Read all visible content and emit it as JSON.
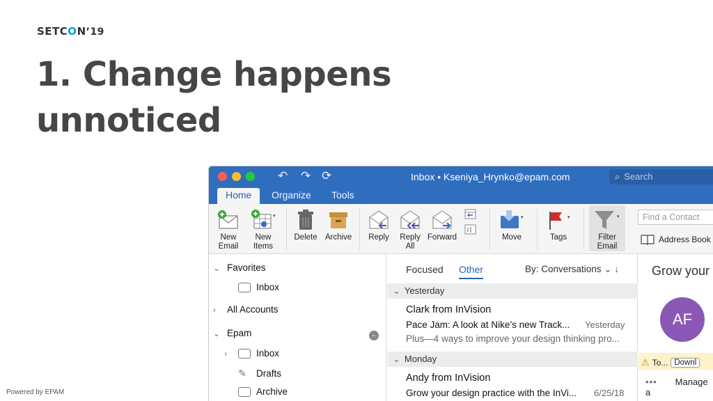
{
  "slide": {
    "logo_a": "SETC",
    "logo_o": "O",
    "logo_b": "N",
    "logo_year": "’19",
    "title_line1": "1. Change happens",
    "title_line2": "unnoticed",
    "footer": "Powered by EPAM"
  },
  "window": {
    "title": "Inbox • Kseniya_Hrynko@epam.com",
    "search_placeholder": "Search",
    "tabs": [
      {
        "label": "Home",
        "active": true
      },
      {
        "label": "Organize",
        "active": false
      },
      {
        "label": "Tools",
        "active": false
      }
    ]
  },
  "ribbon": {
    "new_email": [
      "New",
      "Email"
    ],
    "new_items": [
      "New",
      "Items"
    ],
    "delete": "Delete",
    "archive": "Archive",
    "reply": "Reply",
    "reply_all": [
      "Reply",
      "All"
    ],
    "forward": "Forward",
    "move": "Move",
    "tags": "Tags",
    "filter_email": [
      "Filter",
      "Email"
    ],
    "find_contact_placeholder": "Find a Contact",
    "address_book": "Address Book"
  },
  "folders": {
    "favorites": "Favorites",
    "fav_inbox": "Inbox",
    "all_accounts": "All Accounts",
    "epam": "Epam",
    "inbox": "Inbox",
    "drafts": "Drafts",
    "archive": "Archive"
  },
  "message_list": {
    "tab_focused": "Focused",
    "tab_other": "Other",
    "sort": "By: Conversations",
    "groups": [
      "Yesterday",
      "Monday"
    ],
    "messages": [
      {
        "from": "Clark from InVision",
        "subject": "Pace Jam: A look at Nike’s new Track...",
        "date": "Yesterday",
        "preview": "Plus—4 ways to improve your design thinking pro..."
      },
      {
        "from": "Andy from InVision",
        "subject": "Grow your design practice with the InVi...",
        "date": "6/25/18"
      }
    ]
  },
  "reading_pane": {
    "title": "Grow your",
    "avatar_initials": "AF",
    "info_text": "To...",
    "download_button": "Downl",
    "manage": "Manage a"
  },
  "colors": {
    "titlebar": "#2f6ebf",
    "accent": "#2b63ad",
    "avatar": "#8a57b6",
    "logo_o": "#0a9dd9"
  }
}
